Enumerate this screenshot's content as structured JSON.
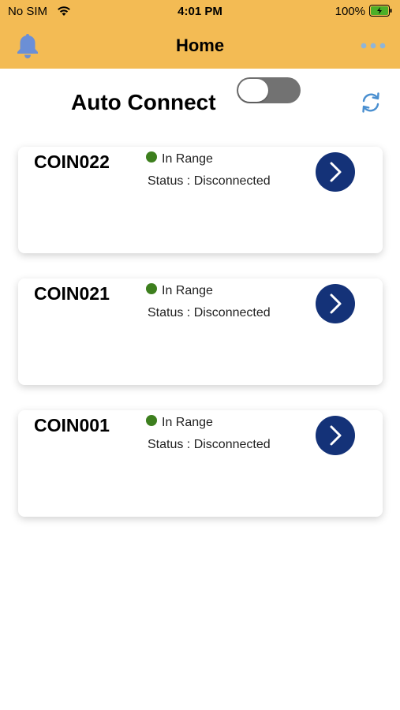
{
  "status_bar": {
    "carrier": "No SIM",
    "time": "4:01 PM",
    "battery_percent": "100%"
  },
  "nav": {
    "title": "Home",
    "left_icon": "bell-icon",
    "right_icon": "more-icon"
  },
  "auto_connect": {
    "label": "Auto Connect",
    "enabled": false,
    "refresh_icon": "refresh-icon"
  },
  "devices": [
    {
      "name": "COIN022",
      "range": "In Range",
      "status": "Status : Disconnected"
    },
    {
      "name": "COIN021",
      "range": "In Range",
      "status": "Status : Disconnected"
    },
    {
      "name": "COIN001",
      "range": "In Range",
      "status": "Status : Disconnected"
    }
  ],
  "colors": {
    "header_bg": "#f3bb54",
    "bell": "#6b8fd6",
    "more_dots": "#8fb5d8",
    "in_range_dot": "#3d7f1e",
    "action_button": "#143278",
    "refresh": "#4a8fd0",
    "battery_fill": "#4caf28"
  }
}
